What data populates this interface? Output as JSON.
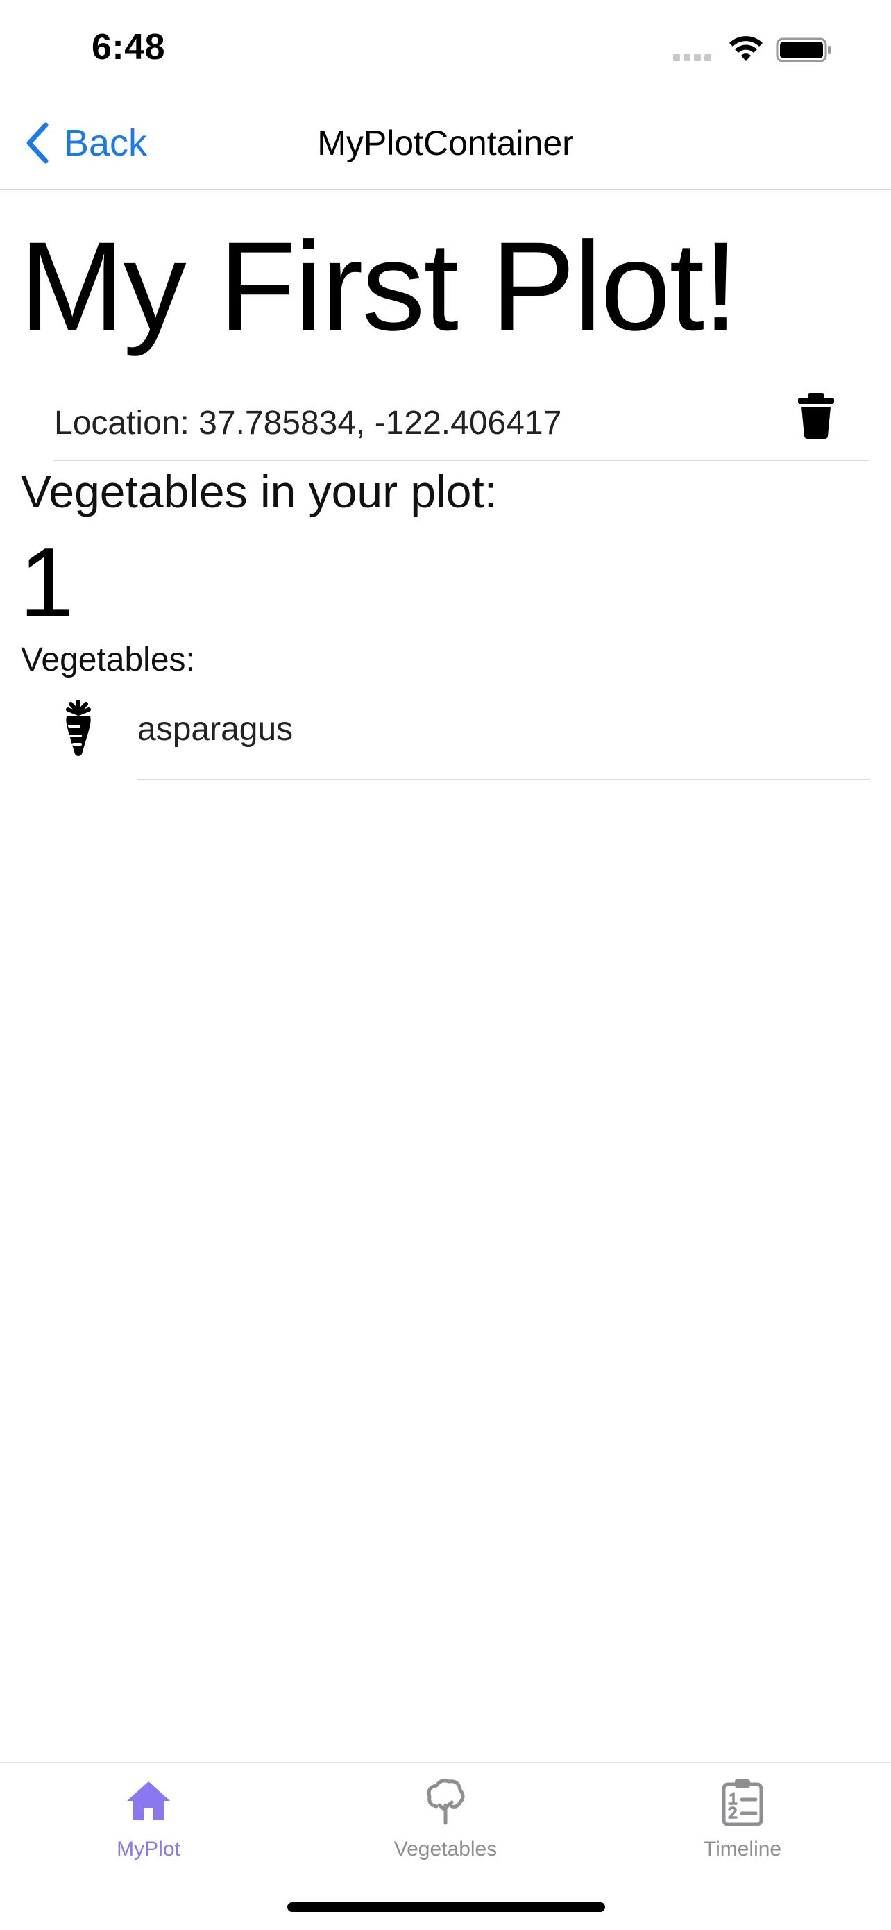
{
  "status_bar": {
    "time": "6:48"
  },
  "nav": {
    "back_label": "Back",
    "title": "MyPlotContainer"
  },
  "plot": {
    "title": "My First Plot!",
    "location": "Location: 37.785834, -122.406417",
    "vegetables_count_label": "Vegetables in your plot:",
    "vegetables_count": "1",
    "vegetables_list_label": "Vegetables:",
    "vegetables": [
      {
        "name": "asparagus",
        "icon": "carrot-icon"
      }
    ]
  },
  "tabs": [
    {
      "label": "MyPlot",
      "icon": "house-icon",
      "active": true
    },
    {
      "label": "Vegetables",
      "icon": "tree-icon",
      "active": false
    },
    {
      "label": "Timeline",
      "icon": "clipboard-list-icon",
      "active": false
    }
  ],
  "colors": {
    "accent_blue": "#1a7ae8",
    "tab_active": "#8a78f0",
    "tab_inactive": "#8e8e93"
  }
}
